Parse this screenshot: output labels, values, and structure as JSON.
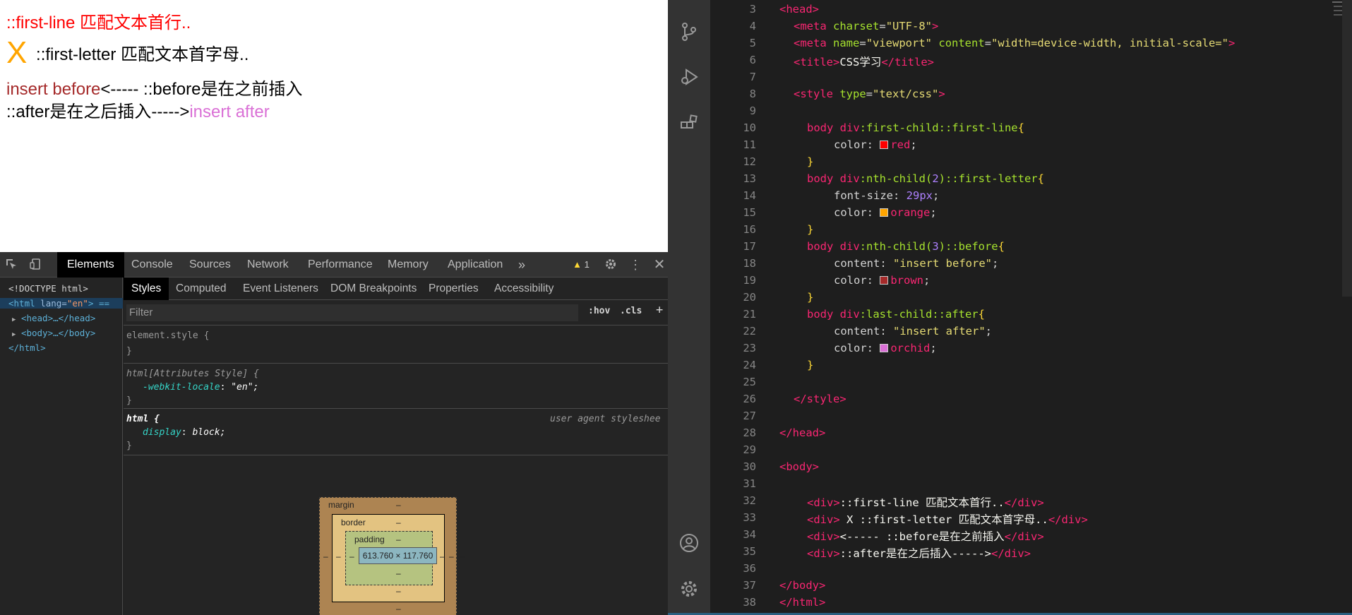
{
  "preview": {
    "line1": "::first-line 匹配文本首行..",
    "line2_first_letter": "X",
    "line2_rest": " ::first-letter 匹配文本首字母..",
    "line3_before": "insert before",
    "line3_rest": "<----- ::before是在之前插入",
    "line4_rest": "::after是在之后插入----->",
    "line4_after": "insert after",
    "colors": {
      "first_line": "#ff0000",
      "first_letter": "#ffa500",
      "before": "#a52a2a",
      "after": "#da70d6"
    }
  },
  "devtools": {
    "tabs": [
      "Elements",
      "Console",
      "Sources",
      "Network",
      "Performance",
      "Memory",
      "Application"
    ],
    "active_tab": "Elements",
    "more_tabs": "»",
    "warning_count": "1",
    "dom": {
      "doctype": "<!DOCTYPE html>",
      "html_open_tag": "<html",
      "html_attr": "lang=",
      "html_val": "\"en\"",
      "html_close": "> ==",
      "head": "<head>…</head>",
      "body": "<body>…</body>",
      "html_end": "</html>"
    },
    "styles_tabs": [
      "Styles",
      "Computed",
      "Event Listeners",
      "DOM Breakpoints",
      "Properties",
      "Accessibility"
    ],
    "filter_placeholder": "Filter",
    "hov": ":hov",
    "cls": ".cls",
    "plus": "+",
    "rules": {
      "element_style": "element.style {",
      "close": "}",
      "attr_style_selector": "html[Attributes Style] {",
      "attr_style_prop": "-webkit-locale",
      "attr_style_val": "\"en\";",
      "html_selector": "html {",
      "ua_label": "user agent styleshee",
      "html_prop": "display",
      "html_val": "block;"
    },
    "box_model": {
      "margin_label": "margin",
      "border_label": "border",
      "padding_label": "padding",
      "content_size": "613.760 × 117.760",
      "dash": "–"
    }
  },
  "editor": {
    "lines": [
      {
        "n": "3"
      },
      {
        "n": "4"
      },
      {
        "n": "5"
      },
      {
        "n": "6"
      },
      {
        "n": "7"
      },
      {
        "n": "8"
      },
      {
        "n": "9"
      },
      {
        "n": "10"
      },
      {
        "n": "11"
      },
      {
        "n": "12"
      },
      {
        "n": "13"
      },
      {
        "n": "14"
      },
      {
        "n": "15"
      },
      {
        "n": "16"
      },
      {
        "n": "17"
      },
      {
        "n": "18"
      },
      {
        "n": "19"
      },
      {
        "n": "20"
      },
      {
        "n": "21"
      },
      {
        "n": "22"
      },
      {
        "n": "23"
      },
      {
        "n": "24"
      },
      {
        "n": "25"
      },
      {
        "n": "26"
      },
      {
        "n": "27"
      },
      {
        "n": "28"
      },
      {
        "n": "29"
      },
      {
        "n": "30"
      },
      {
        "n": "31"
      },
      {
        "n": "32"
      },
      {
        "n": "33"
      },
      {
        "n": "34"
      },
      {
        "n": "35"
      },
      {
        "n": "36"
      },
      {
        "n": "37"
      },
      {
        "n": "38"
      }
    ],
    "code": {
      "head_open": "<head>",
      "meta_charset_tag": "<meta",
      "meta_charset_attr": "charset",
      "meta_charset_val": "\"UTF-8\"",
      "meta_vp_attr1": "name",
      "meta_vp_val1": "\"viewport\"",
      "meta_vp_attr2": "content",
      "meta_vp_val2": "\"width=device-width, initial-scale=\"",
      "title_open": "<title>",
      "title_text": "CSS学习",
      "title_close": "</title>",
      "style_open_tag": "<style",
      "style_attr": "type",
      "style_val": "\"text/css\"",
      "sel1_el": "body div",
      "sel1_pseudo": ":first-child::first-line",
      "sel2_el": "body div",
      "sel2_pseudo": ":nth-child(",
      "sel2_num": "2",
      "sel2_pseudo_end": ")::first-letter",
      "sel3_el": "body div",
      "sel3_pseudo": ":nth-child(",
      "sel3_num": "3",
      "sel3_pseudo_end": ")::before",
      "sel4_el": "body div",
      "sel4_pseudo": ":last-child::after",
      "prop_color": "color",
      "prop_font_size": "font-size",
      "prop_content": "content",
      "val_red": "red",
      "val_orange": "orange",
      "val_brown": "brown",
      "val_orchid": "orchid",
      "val_29px": "29px",
      "val_insert_before": "\"insert before\"",
      "val_insert_after": "\"insert after\"",
      "style_close": "</style>",
      "head_close": "</head>",
      "body_open": "<body>",
      "div1": "::first-line 匹配文本首行..",
      "div2": " X ::first-letter 匹配文本首字母..",
      "div3": "<----- ::before是在之前插入",
      "div4": "::after是在之后插入----->",
      "div_open": "<div>",
      "div_close": "</div>",
      "body_close": "</body>",
      "html_close": "</html>"
    },
    "swatches": {
      "red": "#ff0000",
      "orange": "#ffa500",
      "brown": "#a52a2a",
      "orchid": "#da70d6"
    }
  },
  "activity_bar": {
    "icons": [
      "source-control-icon",
      "run-debug-icon",
      "extensions-icon",
      "account-icon",
      "settings-gear-icon"
    ]
  }
}
